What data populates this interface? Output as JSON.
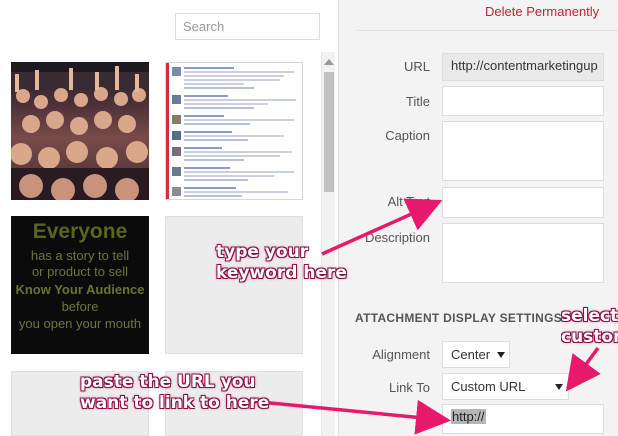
{
  "library": {
    "search_placeholder": "Search",
    "tile3": {
      "title": "Everyone",
      "lines": [
        "has a story to tell",
        "or product to sell",
        "Know Your Audience",
        "before",
        "you open your mouth"
      ]
    }
  },
  "details": {
    "delete_label": "Delete Permanently",
    "fields": {
      "url_label": "URL",
      "url_value": "http://contentmarketingup",
      "title_label": "Title",
      "caption_label": "Caption",
      "alt_label": "Alt Text",
      "description_label": "Description"
    },
    "display_settings": {
      "title": "ATTACHMENT DISPLAY SETTINGS",
      "alignment_label": "Alignment",
      "alignment_value": "Center",
      "link_to_label": "Link To",
      "link_to_value": "Custom URL",
      "link_url_value": "http://"
    }
  },
  "annotations": {
    "keyword_line1": "type your",
    "keyword_line2": "keyword here",
    "select_line1": "select",
    "select_line2": "custom",
    "paste_line1": "paste the URL you",
    "paste_line2": "want to link to here",
    "color": "#e8196b"
  }
}
